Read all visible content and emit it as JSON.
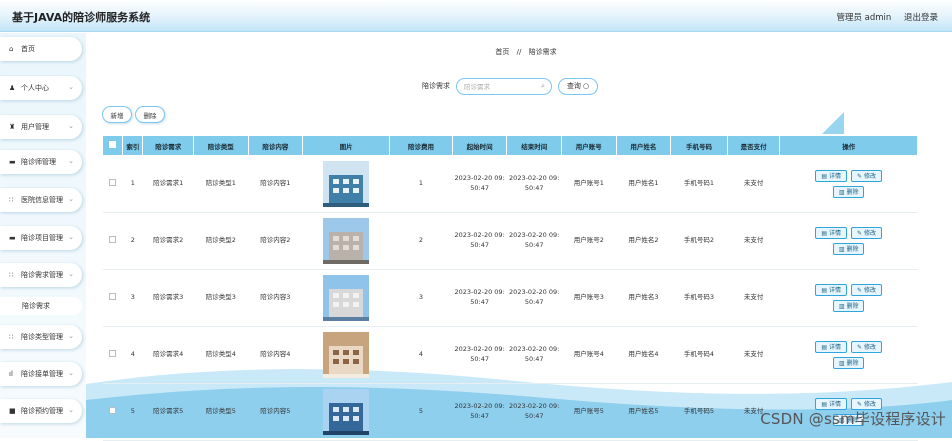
{
  "header": {
    "title": "基于JAVA的陪诊师服务系统",
    "user_label": "管理员 admin",
    "logout": "退出登录"
  },
  "sidebar": {
    "items": [
      {
        "label": "首页",
        "icon": "home-icon",
        "glyph": "⌂"
      },
      {
        "label": "个人中心",
        "icon": "user-icon",
        "glyph": "♟"
      },
      {
        "label": "用户管理",
        "icon": "user-icon",
        "glyph": "♜"
      },
      {
        "label": "陪诊师管理",
        "icon": "folder-icon",
        "glyph": "▬"
      },
      {
        "label": "医院信息管理",
        "icon": "grid-icon",
        "glyph": "∷"
      },
      {
        "label": "陪诊项目管理",
        "icon": "folder-icon",
        "glyph": "▬"
      },
      {
        "label": "陪诊需求管理",
        "icon": "grid-icon",
        "glyph": "∷"
      },
      {
        "label": "陪诊类型管理",
        "icon": "grid-icon",
        "glyph": "∷"
      },
      {
        "label": "陪诊接单管理",
        "icon": "chart-icon",
        "glyph": "ıl"
      },
      {
        "label": "陪诊预约管理",
        "icon": "lock-icon",
        "glyph": "■"
      }
    ],
    "sub_item": "陪诊需求"
  },
  "breadcrumb": {
    "home": "首页",
    "sep": "//",
    "current": "陪诊需求"
  },
  "search": {
    "label": "陪诊需求",
    "placeholder": "陪诊需求",
    "button": "查询"
  },
  "actions": {
    "add": "新增",
    "delete": "删除"
  },
  "table": {
    "headers": [
      "索引",
      "陪诊需求",
      "陪诊类型",
      "陪诊内容",
      "图片",
      "陪诊费用",
      "起始时间",
      "结束时间",
      "用户账号",
      "用户姓名",
      "手机号码",
      "是否支付",
      "操作"
    ],
    "rows": [
      {
        "index": "1",
        "need": "陪诊需求1",
        "type": "陪诊类型1",
        "content": "陪诊内容1",
        "fee": "1",
        "start1": "2023-02-20 09:",
        "start2": "50:47",
        "end1": "2023-02-20 09:",
        "end2": "50:47",
        "account": "用户账号1",
        "name": "用户姓名1",
        "phone": "手机号码1",
        "paid": "未支付"
      },
      {
        "index": "2",
        "need": "陪诊需求2",
        "type": "陪诊类型2",
        "content": "陪诊内容2",
        "fee": "2",
        "start1": "2023-02-20 09:",
        "start2": "50:47",
        "end1": "2023-02-20 09:",
        "end2": "50:47",
        "account": "用户账号2",
        "name": "用户姓名2",
        "phone": "手机号码2",
        "paid": "未支付"
      },
      {
        "index": "3",
        "need": "陪诊需求3",
        "type": "陪诊类型3",
        "content": "陪诊内容3",
        "fee": "3",
        "start1": "2023-02-20 09:",
        "start2": "50:47",
        "end1": "2023-02-20 09:",
        "end2": "50:47",
        "account": "用户账号3",
        "name": "用户姓名3",
        "phone": "手机号码3",
        "paid": "未支付"
      },
      {
        "index": "4",
        "need": "陪诊需求4",
        "type": "陪诊类型4",
        "content": "陪诊内容4",
        "fee": "4",
        "start1": "2023-02-20 09:",
        "start2": "50:47",
        "end1": "2023-02-20 09:",
        "end2": "50:47",
        "account": "用户账号4",
        "name": "用户姓名4",
        "phone": "手机号码4",
        "paid": "未支付"
      },
      {
        "index": "5",
        "need": "陪诊需求5",
        "type": "陪诊类型5",
        "content": "陪诊内容5",
        "fee": "5",
        "start1": "2023-02-20 09:",
        "start2": "50:47",
        "end1": "2023-02-20 09:",
        "end2": "50:47",
        "account": "用户账号5",
        "name": "用户姓名5",
        "phone": "手机号码5",
        "paid": "未支付"
      }
    ],
    "op_detail": "详情",
    "op_edit": "修改",
    "op_delete": "删除"
  },
  "watermark": "CSDN @ssm毕设程序设计",
  "colors": {
    "accent": "#7ecbec",
    "header_grad_end": "#c2e6f7"
  }
}
